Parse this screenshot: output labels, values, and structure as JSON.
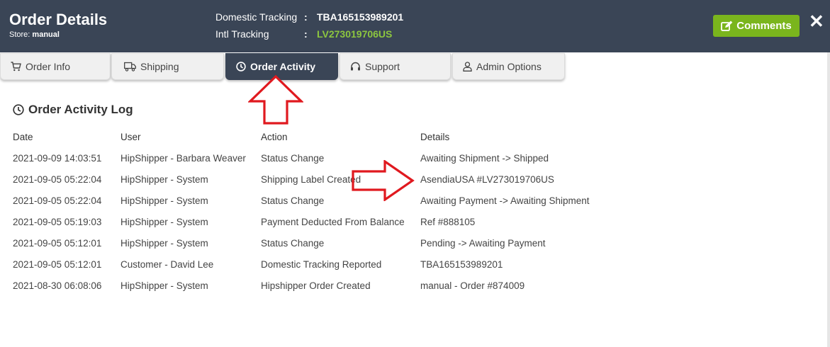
{
  "header": {
    "title": "Order Details",
    "store_label": "Store:",
    "store_value": "manual",
    "domestic_label": "Domestic Tracking",
    "domestic_value": "TBA165153989201",
    "intl_label": "Intl Tracking",
    "intl_value": "LV273019706US",
    "colon": ":",
    "comments_label": "Comments",
    "close_label": "✕"
  },
  "colors": {
    "header_bg": "#3a4556",
    "accent_green": "#7ab51d",
    "intl_tracking": "#8cc63f",
    "annotation_red": "#e0191f"
  },
  "tabs": [
    {
      "label": "Order Info",
      "icon": "cart-icon"
    },
    {
      "label": "Shipping",
      "icon": "truck-icon"
    },
    {
      "label": "Order Activity",
      "icon": "clock-icon",
      "active": true
    },
    {
      "label": "Support",
      "icon": "headset-icon"
    },
    {
      "label": "Admin Options",
      "icon": "user-icon"
    }
  ],
  "log": {
    "title": "Order Activity Log",
    "columns": [
      "Date",
      "User",
      "Action",
      "Details"
    ],
    "rows": [
      [
        "2021-09-09 14:03:51",
        "HipShipper - Barbara Weaver",
        "Status Change",
        "Awaiting Shipment -> Shipped"
      ],
      [
        "2021-09-05 05:22:04",
        "HipShipper - System",
        "Shipping Label Created",
        "AsendiaUSA #LV273019706US"
      ],
      [
        "2021-09-05 05:22:04",
        "HipShipper - System",
        "Status Change",
        "Awaiting Payment -> Awaiting Shipment"
      ],
      [
        "2021-09-05 05:19:03",
        "HipShipper - System",
        "Payment Deducted From Balance",
        "Ref #888105"
      ],
      [
        "2021-09-05 05:12:01",
        "HipShipper - System",
        "Status Change",
        "Pending -> Awaiting Payment"
      ],
      [
        "2021-09-05 05:12:01",
        "Customer - David Lee",
        "Domestic Tracking Reported",
        "TBA165153989201"
      ],
      [
        "2021-08-30 06:08:06",
        "HipShipper - System",
        "Hipshipper Order Created",
        "manual - Order #874009"
      ]
    ]
  }
}
